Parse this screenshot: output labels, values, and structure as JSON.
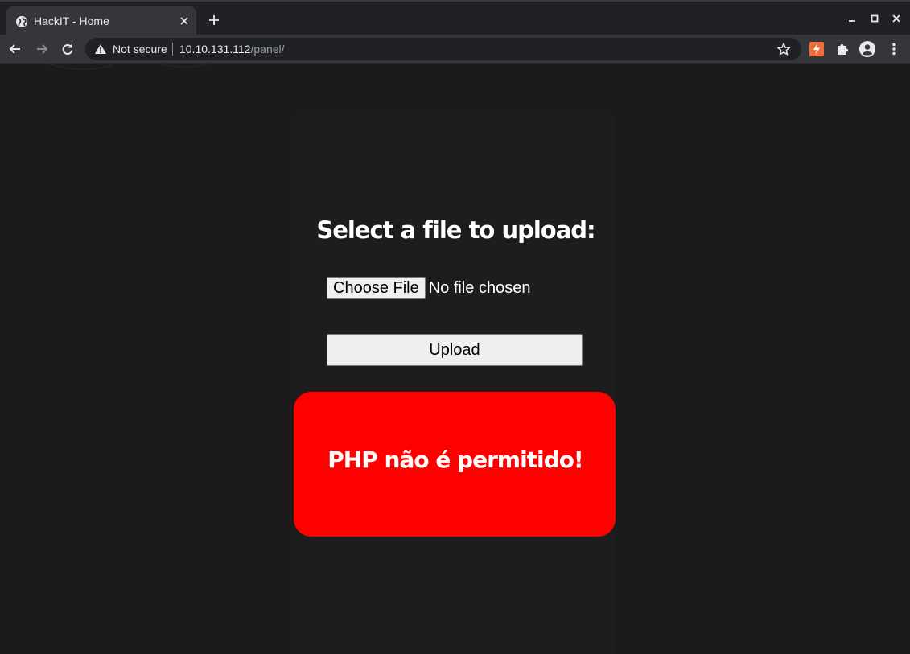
{
  "browser": {
    "tab": {
      "title": "HackIT - Home",
      "favicon_icon": "globe-icon",
      "close_icon": "close-icon"
    },
    "new_tab_icon": "plus-icon",
    "window_controls": [
      "minimize-icon",
      "maximize-icon",
      "close-icon"
    ],
    "toolbar": {
      "back_icon": "arrow-left-icon",
      "forward_icon": "arrow-right-icon",
      "reload_icon": "reload-icon",
      "security_icon": "warning-icon",
      "security_label": "Not secure",
      "url_host": "10.10.131.112",
      "url_path": "/panel/",
      "bookmark_icon": "star-icon",
      "extensions": [
        "lightning-extension-icon",
        "puzzle-icon",
        "account-icon",
        "menu-dots-icon"
      ]
    }
  },
  "page": {
    "heading": "Select a file to upload:",
    "file_input": {
      "button_label": "Choose File",
      "status": "No file chosen"
    },
    "upload_button": "Upload",
    "error_message": "PHP não é permitido!",
    "colors": {
      "background": "#1b1b1b",
      "error_background": "#ff0000",
      "text": "#ffffff"
    }
  }
}
